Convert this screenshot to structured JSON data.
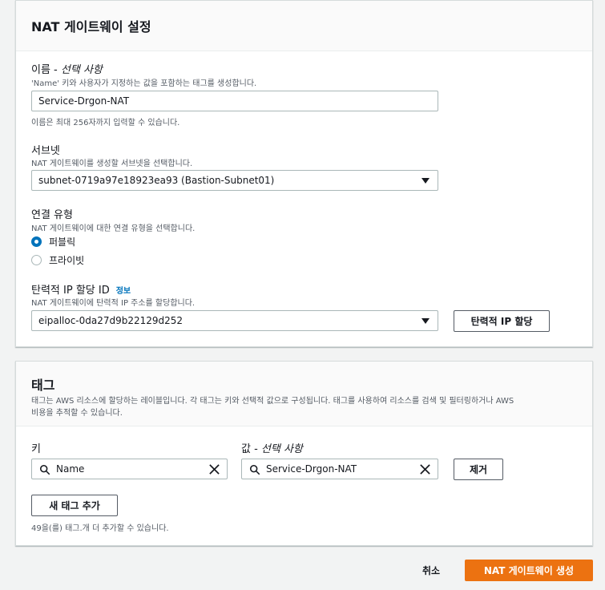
{
  "nat_settings": {
    "title": "NAT 게이트웨이 설정",
    "name": {
      "label": "이름 - ",
      "label_optional": "선택 사항",
      "description": "'Name' 키와 사용자가 지정하는 값을 포함하는 태그를 생성합니다.",
      "value": "Service-Drgon-NAT",
      "hint": "이름은 최대 256자까지 입력할 수 있습니다."
    },
    "subnet": {
      "label": "서브넷",
      "description": "NAT 게이트웨이를 생성할 서브넷을 선택합니다.",
      "value": "subnet-0719a97e18923ea93 (Bastion-Subnet01)"
    },
    "connectivity": {
      "label": "연결 유형",
      "description": "NAT 게이트웨이에 대한 연결 유형을 선택합니다.",
      "options": [
        "퍼블릭",
        "프라이빗"
      ],
      "selected": "퍼블릭"
    },
    "eip": {
      "label": "탄력적 IP 할당 ID",
      "info_link": "정보",
      "description": "NAT 게이트웨이에 탄력적 IP 주소를 할당합니다.",
      "value": "eipalloc-0da27d9b22129d252",
      "allocate_button": "탄력적 IP 할당"
    }
  },
  "tags": {
    "title": "태그",
    "description_line1": "태그는 AWS 리소스에 할당하는 레이블입니다. 각 태그는 키와 선택적 값으로 구성됩니다. 태그를 사용하여 리소스를 검색 및 필터링하거나 AWS",
    "description_line2": "비용을 추적할 수 있습니다.",
    "key_label": "키",
    "value_label": "값 - ",
    "value_label_optional": "선택 사항",
    "rows": [
      {
        "key": "Name",
        "value": "Service-Drgon-NAT",
        "remove_button": "제거"
      }
    ],
    "add_button": "새 태그 추가",
    "remaining_hint": "49을(를) 태그.개 더 추가할 수 있습니다."
  },
  "footer": {
    "cancel_label": "취소",
    "create_label": "NAT 게이트웨이 생성"
  },
  "colors": {
    "primary_button": "#ec7211",
    "link": "#0073bb",
    "radio_selected": "#0073bb"
  },
  "icons": [
    "search-icon",
    "clear-icon",
    "caret-down-icon"
  ]
}
